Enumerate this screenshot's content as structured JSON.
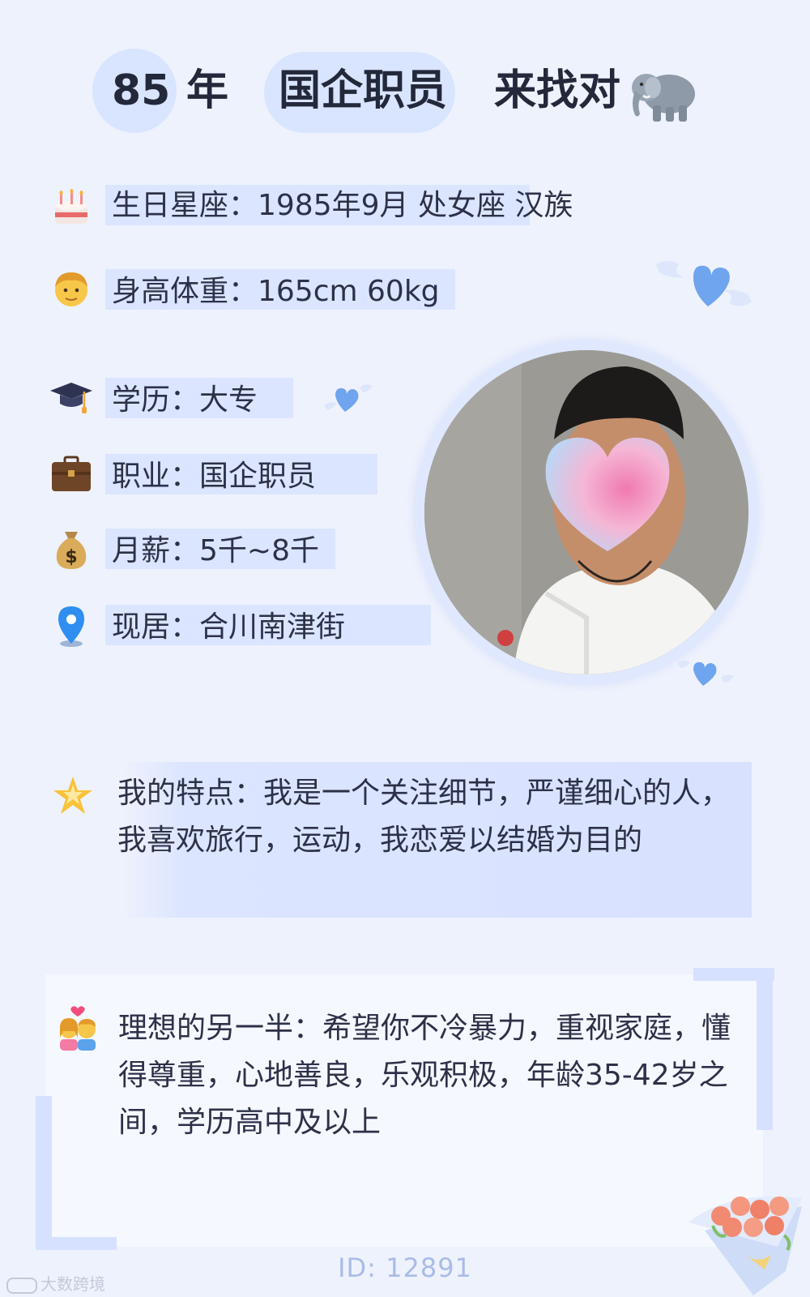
{
  "header": {
    "age": "85",
    "age_unit": "年",
    "occupation": "国企职员",
    "tagline": "来找对"
  },
  "info": {
    "birth": "生日星座：1985年9月 处女座 汉族",
    "height_weight": "身高体重：165cm 60kg",
    "education": "学历：大专",
    "job": "职业：国企职员",
    "salary": "月薪：5千~8千",
    "residence": "现居：合川南津街"
  },
  "features": {
    "text": "我的特点：我是一个关注细节，严谨细心的人，我喜欢旅行，运动，我恋爱以结婚为目的"
  },
  "ideal": {
    "text": "理想的另一半：希望你不冷暴力，重视家庭，懂得尊重，心地善良，乐观积极，年龄35-42岁之间，学历高中及以上"
  },
  "footer": {
    "id": "ID: 12891",
    "watermark": "大数跨境"
  },
  "icons": {
    "title_emoji": "elephant-icon",
    "birth": "cake-icon",
    "height_weight": "man-face-icon",
    "education": "graduation-cap-icon",
    "job": "briefcase-icon",
    "salary": "money-bag-icon",
    "residence": "location-pin-icon",
    "features": "star-icon",
    "ideal": "couple-icon"
  },
  "colors": {
    "background": "#eef2fd",
    "highlight": "#dbe5ff",
    "accent_blue": "#6a9ef0",
    "id_text": "#aabbe6"
  }
}
